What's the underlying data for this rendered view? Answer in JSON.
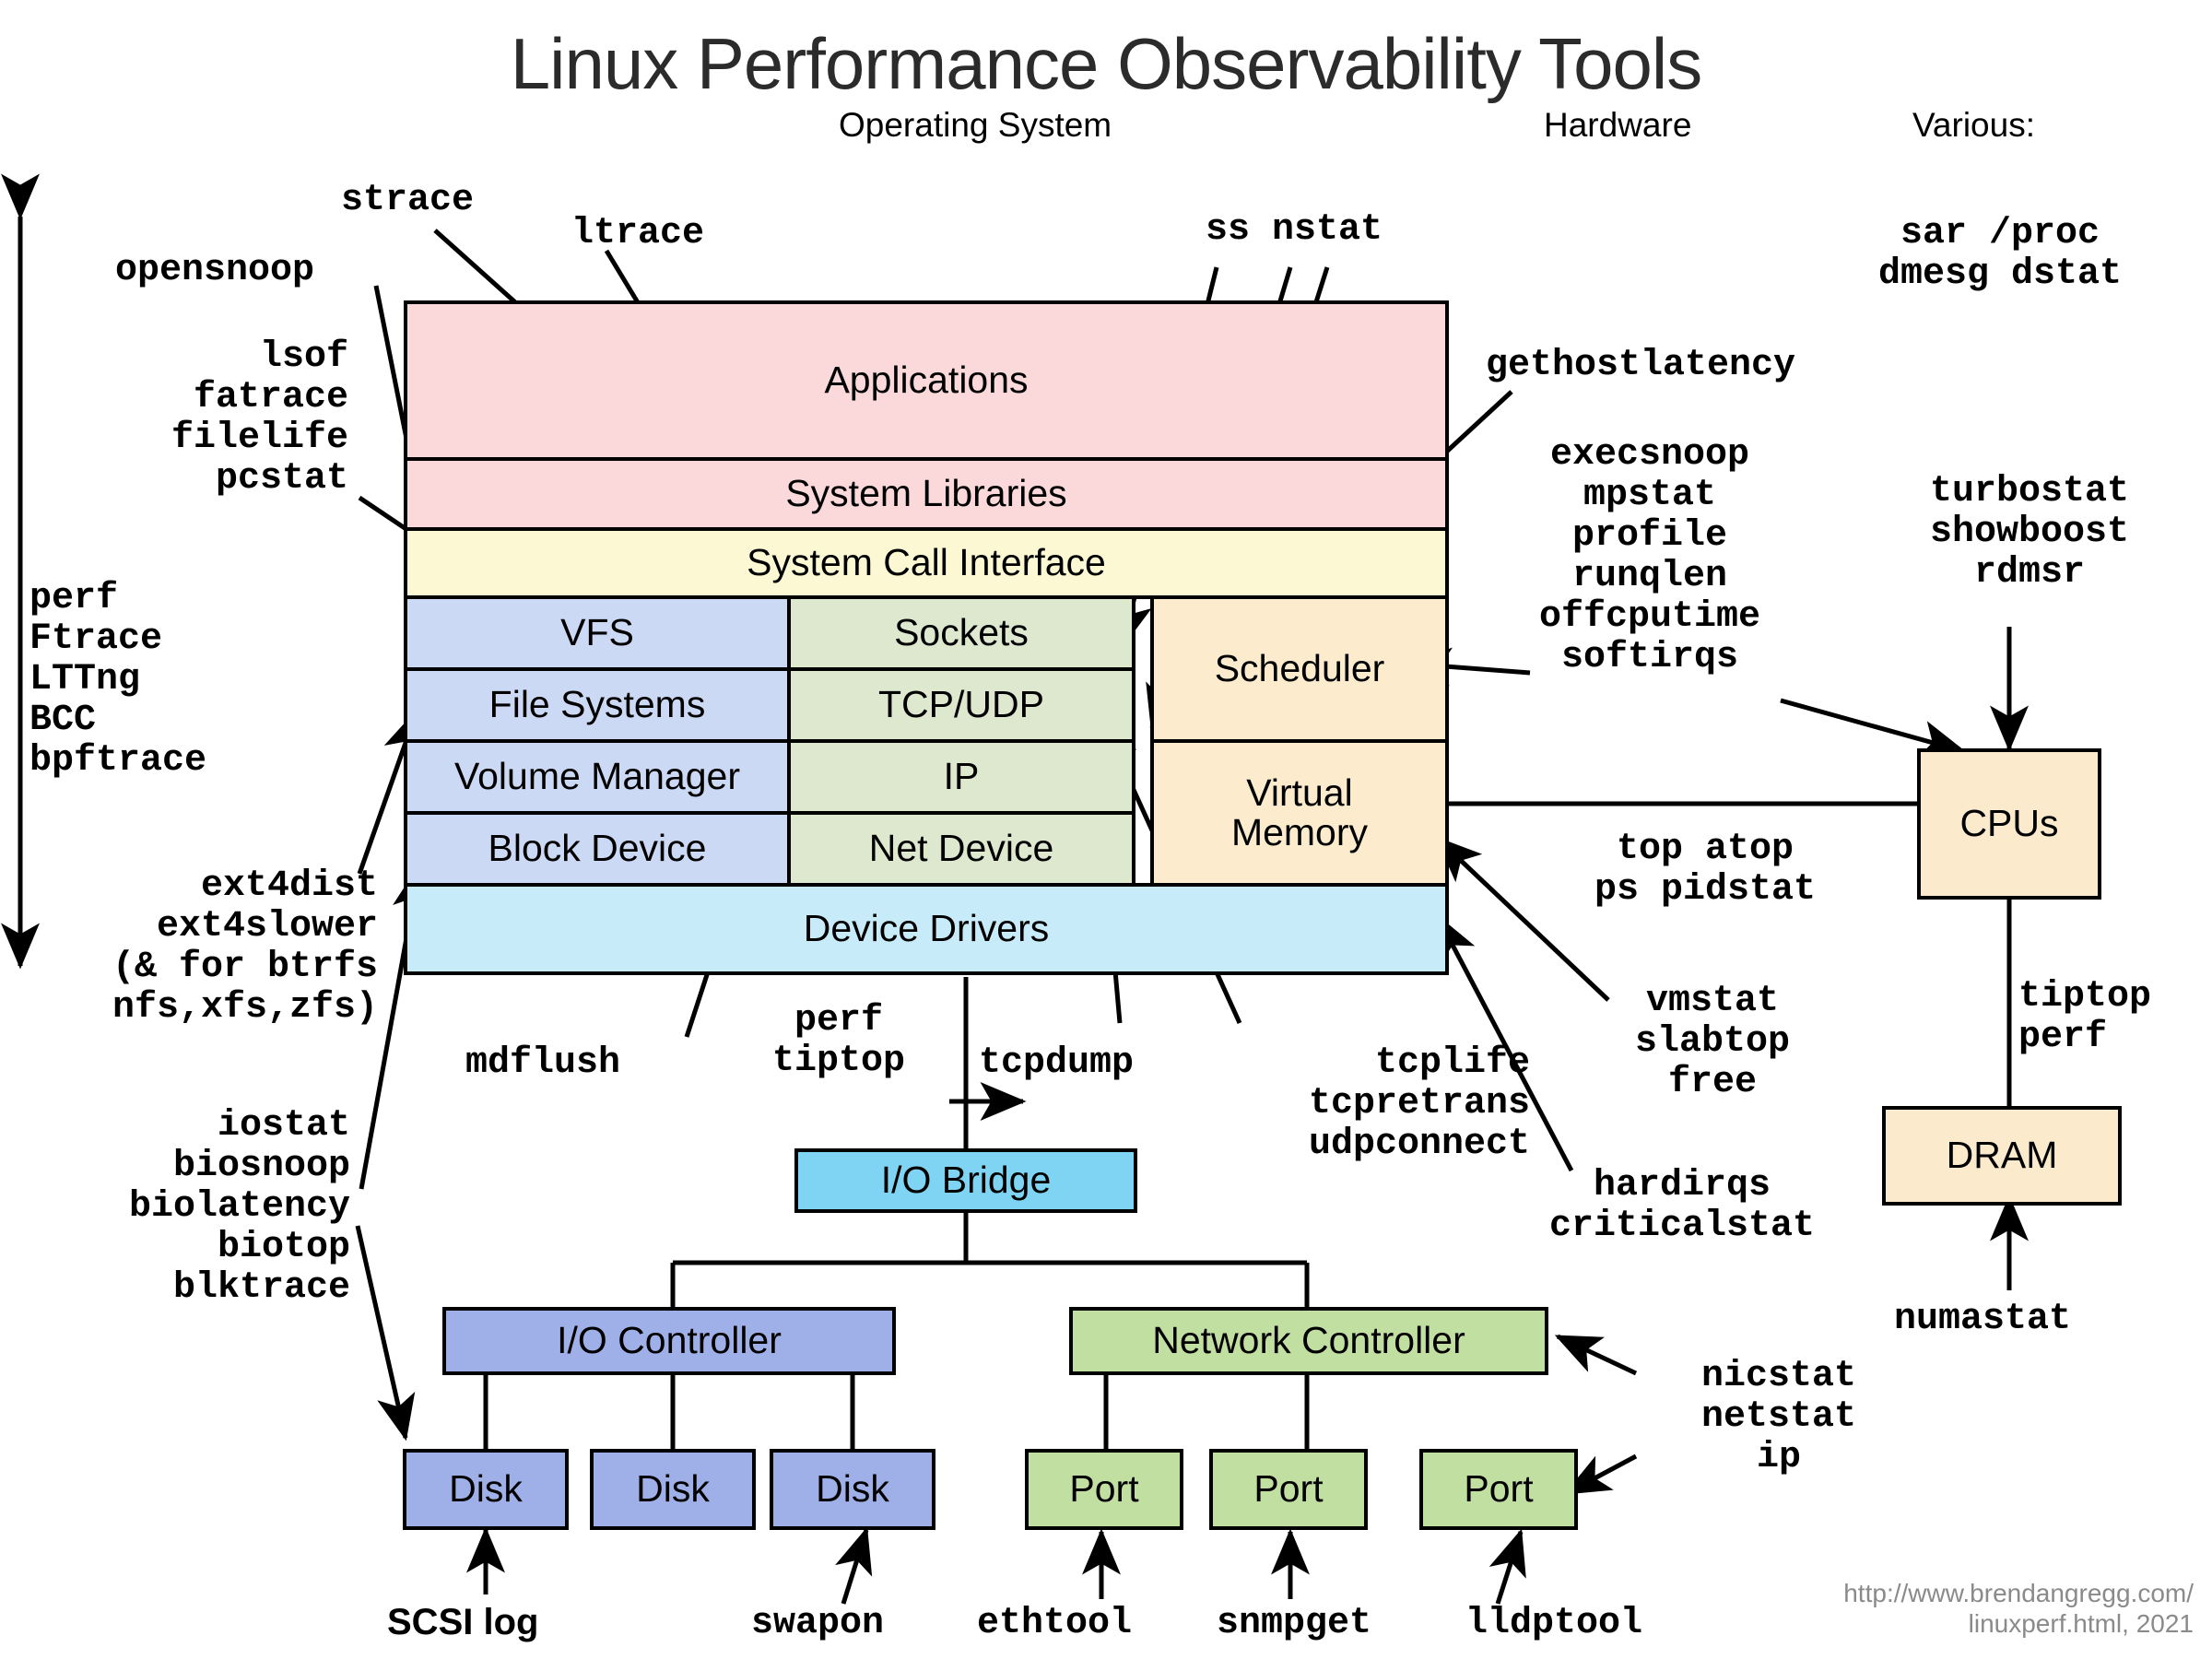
{
  "title": "Linux Performance Observability Tools",
  "captions": {
    "operating_system": "Operating System",
    "hardware": "Hardware",
    "various": "Various:"
  },
  "stack": {
    "applications": "Applications",
    "system_libraries": "System Libraries",
    "system_call_interface": "System Call Interface",
    "vfs": "VFS",
    "file_systems": "File Systems",
    "volume_manager": "Volume Manager",
    "block_device": "Block Device",
    "sockets": "Sockets",
    "tcp_udp": "TCP/UDP",
    "ip": "IP",
    "net_device": "Net Device",
    "scheduler": "Scheduler",
    "virtual_memory": "Virtual\nMemory",
    "device_drivers": "Device Drivers"
  },
  "hardware": {
    "cpus": "CPUs",
    "dram": "DRAM",
    "io_bridge": "I/O Bridge",
    "io_controller": "I/O Controller",
    "network_controller": "Network Controller",
    "disk1": "Disk",
    "disk2": "Disk",
    "disk3": "Disk",
    "port1": "Port",
    "port2": "Port",
    "port3": "Port"
  },
  "tools": {
    "various_list": "sar /proc\ndmesg dstat",
    "strace": "strace",
    "ltrace": "ltrace",
    "ss_nstat": "ss nstat",
    "opensnoop": "opensnoop",
    "lsof_group": "lsof\nfatrace\nfilelife\npcstat",
    "tracers": "perf\nFtrace\nLTTng\nBCC\nbpftrace",
    "ext4_group": "ext4dist\next4slower\n(& for btrfs\nnfs,xfs,zfs)",
    "io_group": "iostat\nbiosnoop\nbiolatency\nbiotop\nblktrace",
    "mdflush": "mdflush",
    "perf_tiptop": "perf\ntiptop",
    "tcpdump": "tcpdump",
    "tcp_group": "tcplife\ntcpretrans\nudpconnect",
    "gethostlatency": "gethostlatency",
    "cpu_group": "execsnoop\nmpstat\nprofile\nrunqlen\noffcputime\nsoftirqs",
    "turbostat_group": "turbostat\nshowboost\nrdmsr",
    "top_group": "top atop\nps pidstat",
    "vmstat_group": "vmstat\nslabtop\nfree",
    "hardirqs_group": "hardirqs\ncriticalstat",
    "tiptop_perf": "tiptop\nperf",
    "numastat": "numastat",
    "nicstat_group": "nicstat\nnetstat\nip",
    "scsi_log": "SCSI log",
    "swapon": "swapon",
    "ethtool": "ethtool",
    "snmpget": "snmpget",
    "lldptool": "lldptool"
  },
  "credit": "http://www.brendangregg.com/\nlinuxperf.html, 2021",
  "colors": {
    "applications": "#fbd8da",
    "syscall": "#fdf8d4",
    "fs_stack": "#ccd9f5",
    "net_stack": "#dde8cf",
    "sched_vm": "#fceccd",
    "device_drivers": "#c8ebfa",
    "io_bridge": "#7fd4f4",
    "io_controller": "#9fb0e8",
    "network_controller": "#c2dfa2",
    "cpu_dram": "#fbeacc",
    "title_text": "#2b2b2b",
    "credit_text": "#8a8a8a"
  }
}
